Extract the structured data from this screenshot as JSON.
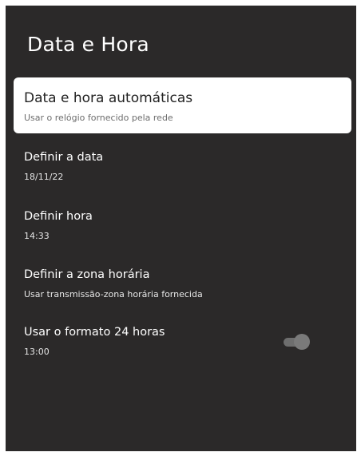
{
  "header": {
    "title": "Data e Hora"
  },
  "settings": [
    {
      "label": "Data e hora automáticas",
      "value": "Usar o relógio fornecido pela rede"
    },
    {
      "label": "Definir a data",
      "value": "18/11/22"
    },
    {
      "label": "Definir hora",
      "value": "14:33"
    },
    {
      "label": "Definir a zona horária",
      "value": "Usar transmissão-zona horária fornecida"
    },
    {
      "label": "Usar o formato 24 horas",
      "value": "13:00",
      "toggle_state": "off"
    }
  ],
  "colors": {
    "panel_background": "#2b2929",
    "focused_item_background": "#ffffff",
    "text_primary": "#ffffff",
    "toggle_off": "#6e6e6e"
  }
}
